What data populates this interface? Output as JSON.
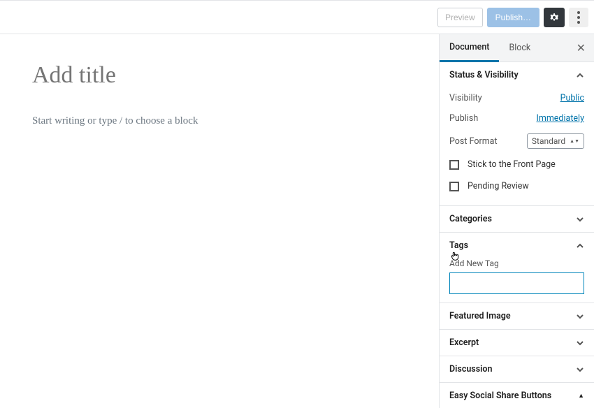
{
  "topbar": {
    "preview": "Preview",
    "publish": "Publish…"
  },
  "editor": {
    "title_placeholder": "Add title",
    "body_placeholder": "Start writing or type / to choose a block"
  },
  "sidebar": {
    "tabs": {
      "document": "Document",
      "block": "Block"
    },
    "status": {
      "title": "Status & Visibility",
      "visibility_label": "Visibility",
      "visibility_value": "Public",
      "publish_label": "Publish",
      "publish_value": "Immediately",
      "format_label": "Post Format",
      "format_value": "Standard",
      "stick_label": "Stick to the Front Page",
      "pending_label": "Pending Review"
    },
    "categories": {
      "title": "Categories"
    },
    "tags": {
      "title": "Tags",
      "add_label": "Add New Tag"
    },
    "featured": {
      "title": "Featured Image"
    },
    "excerpt": {
      "title": "Excerpt"
    },
    "discussion": {
      "title": "Discussion"
    },
    "social": {
      "title": "Easy Social Share Buttons"
    }
  }
}
